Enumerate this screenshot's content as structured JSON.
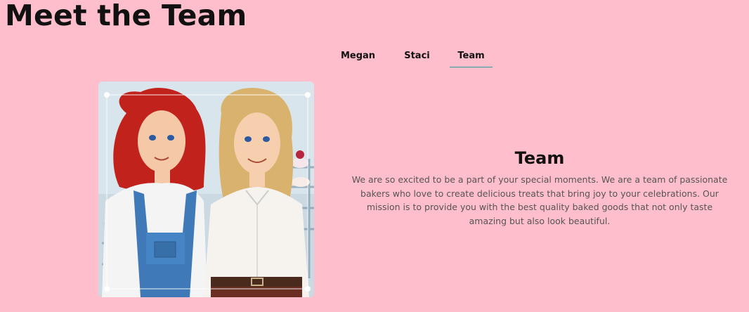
{
  "page": {
    "title": "Meet the Team"
  },
  "tabs": [
    {
      "label": "Megan",
      "active": false
    },
    {
      "label": "Staci",
      "active": false
    },
    {
      "label": "Team",
      "active": true
    }
  ],
  "content": {
    "heading": "Team",
    "body": "We are so excited to be a part of your special moments. We are a team of passionate bakers who love to create delicious treats that bring joy to your celebrations. Our mission is to provide you with the best quality baked goods that not only taste amazing but also look beautiful."
  },
  "colors": {
    "background": "#ffbecb",
    "active_tab_underline": "#2a9d9a",
    "body_text": "#555555"
  }
}
